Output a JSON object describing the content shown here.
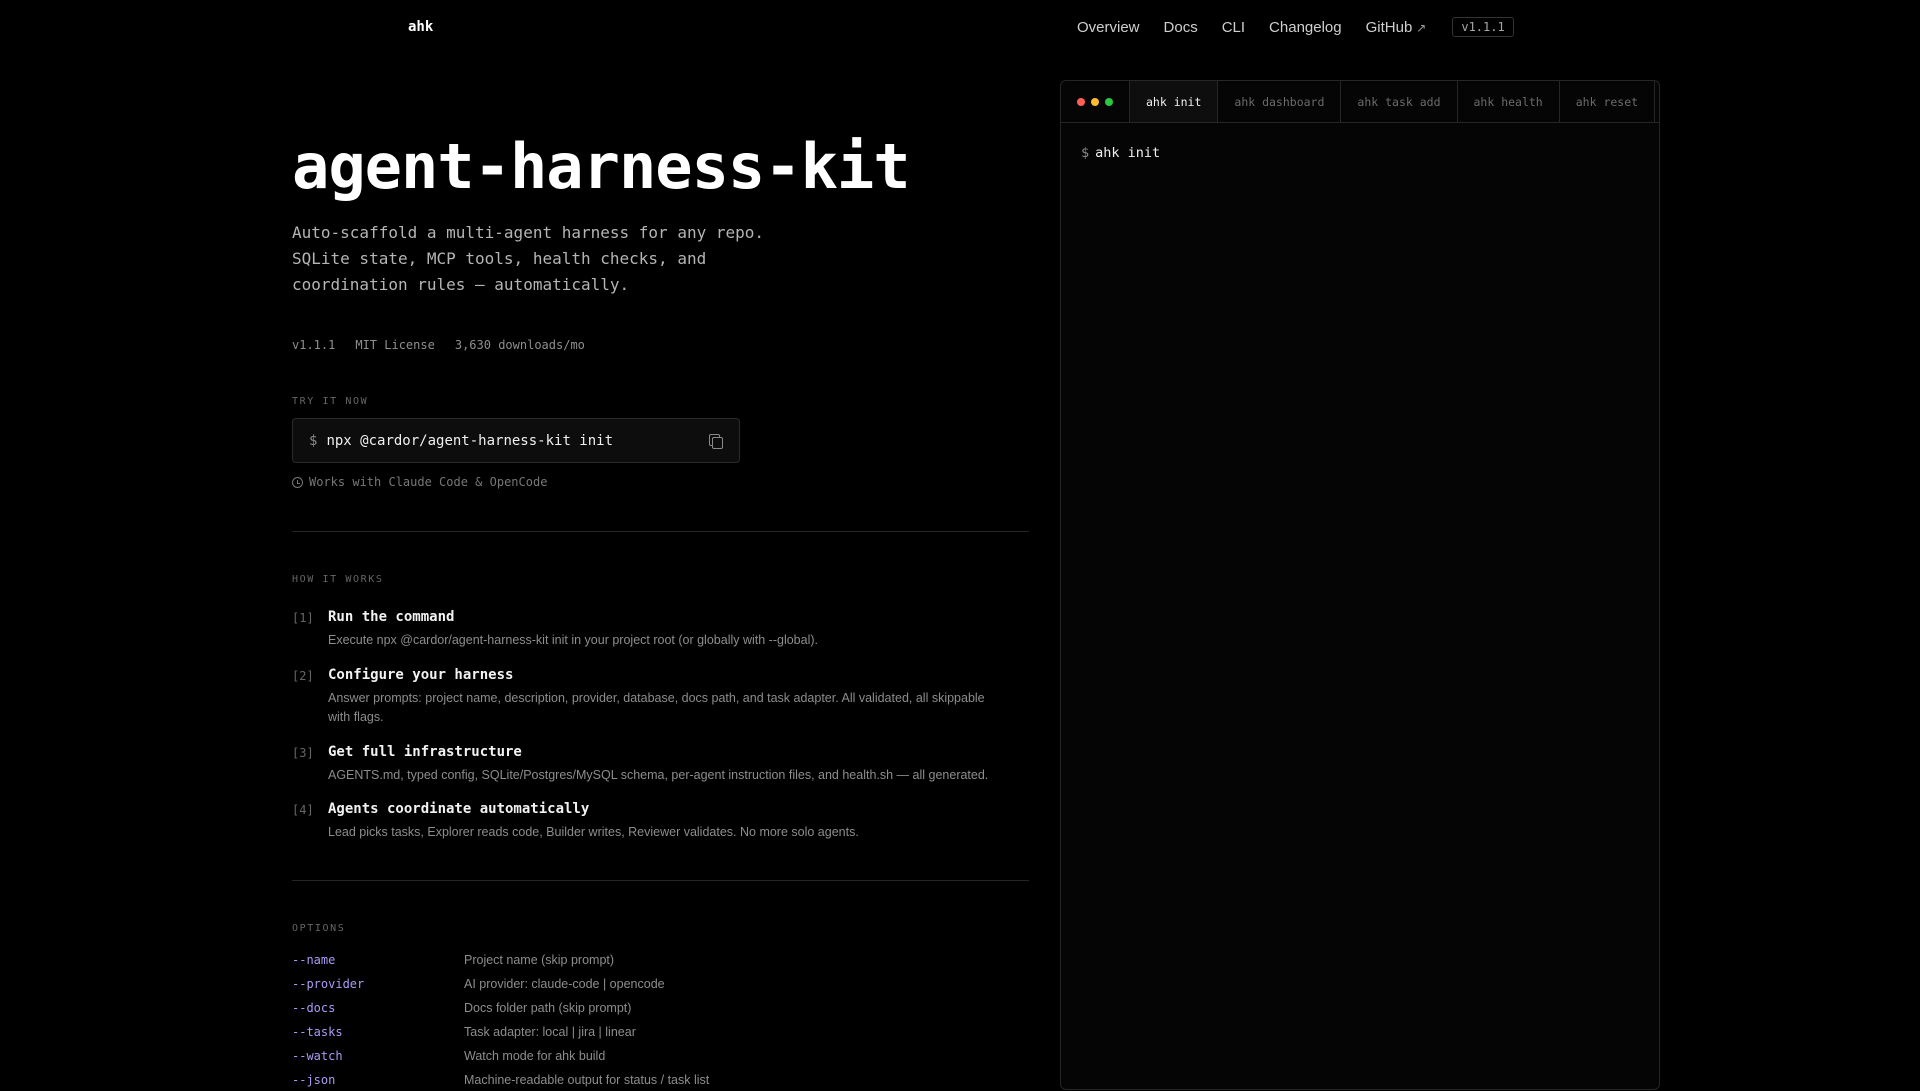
{
  "nav": {
    "brand": "ahk",
    "links": [
      "Overview",
      "Docs",
      "CLI",
      "Changelog",
      "GitHub"
    ],
    "github_ext": "↗",
    "version": "v1.1.1"
  },
  "hero": {
    "title": "agent-harness-kit",
    "subtitle_lines": [
      "Auto-scaffold a multi-agent harness for any repo.",
      "SQLite state, MCP tools, health checks, and",
      "coordination rules — automatically."
    ],
    "meta": {
      "version": "v1.1.1",
      "license": "MIT License",
      "downloads": "3,630 downloads/mo"
    }
  },
  "try_it": {
    "label": "TRY IT NOW",
    "prompt": "$",
    "command": "npx @cardor/agent-harness-kit init",
    "works_with": "Works with Claude Code & OpenCode"
  },
  "how_it_works": {
    "label": "HOW IT WORKS",
    "steps": [
      {
        "num": "[1]",
        "title": "Run the command",
        "desc": "Execute npx @cardor/agent-harness-kit init in your project root (or globally with --global)."
      },
      {
        "num": "[2]",
        "title": "Configure your harness",
        "desc": "Answer prompts: project name, description, provider, database, docs path, and task adapter. All validated, all skippable with flags."
      },
      {
        "num": "[3]",
        "title": "Get full infrastructure",
        "desc": "AGENTS.md, typed config, SQLite/Postgres/MySQL schema, per-agent instruction files, and health.sh — all generated."
      },
      {
        "num": "[4]",
        "title": "Agents coordinate automatically",
        "desc": "Lead picks tasks, Explorer reads code, Builder writes, Reviewer validates. No more solo agents."
      }
    ]
  },
  "options": {
    "label": "OPTIONS",
    "rows": [
      {
        "flag": "--name",
        "desc": "Project name (skip prompt)"
      },
      {
        "flag": "--provider",
        "desc": "AI provider: claude-code | opencode"
      },
      {
        "flag": "--docs",
        "desc": "Docs folder path (skip prompt)"
      },
      {
        "flag": "--tasks",
        "desc": "Task adapter: local | jira | linear"
      },
      {
        "flag": "--watch",
        "desc": "Watch mode for ahk build"
      },
      {
        "flag": "--json",
        "desc": "Machine-readable output for status / task list"
      }
    ]
  },
  "terminal": {
    "tabs": [
      "ahk init",
      "ahk dashboard",
      "ahk task add",
      "ahk health",
      "ahk reset"
    ],
    "active_tab": 0,
    "prompt": "$",
    "command": "ahk init",
    "dot_colors": [
      "#ff5f57",
      "#febc2e",
      "#28c840"
    ]
  }
}
